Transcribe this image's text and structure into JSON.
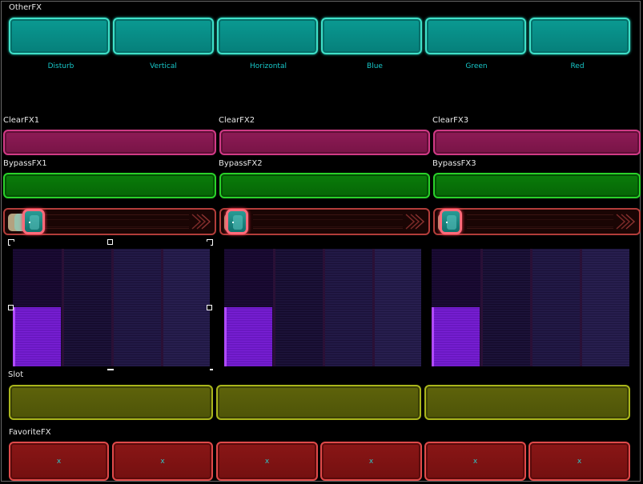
{
  "other_fx": {
    "title": "OtherFX",
    "buttons": [
      {
        "label": "Disturb"
      },
      {
        "label": "Vertical"
      },
      {
        "label": "Horizontal"
      },
      {
        "label": "Blue"
      },
      {
        "label": "Green"
      },
      {
        "label": "Red"
      }
    ]
  },
  "channels": [
    {
      "clear_title": "ClearFX1",
      "bypass_title": "BypassFX1"
    },
    {
      "clear_title": "ClearFX2",
      "bypass_title": "BypassFX2"
    },
    {
      "clear_title": "ClearFX3",
      "bypass_title": "BypassFX3"
    }
  ],
  "slot": {
    "title": "Slot"
  },
  "favorite_fx": {
    "title": "FavoriteFX",
    "buttons": [
      {
        "label": "x"
      },
      {
        "label": "x"
      },
      {
        "label": "x"
      },
      {
        "label": "x"
      },
      {
        "label": "x"
      },
      {
        "label": "x"
      }
    ]
  },
  "colors": {
    "teal": "#0a9a92",
    "magenta": "#8e1b56",
    "green": "#0a7d0a",
    "olive": "#5e630b",
    "red": "#8a1616",
    "meter_fill": "#7a20d6"
  }
}
